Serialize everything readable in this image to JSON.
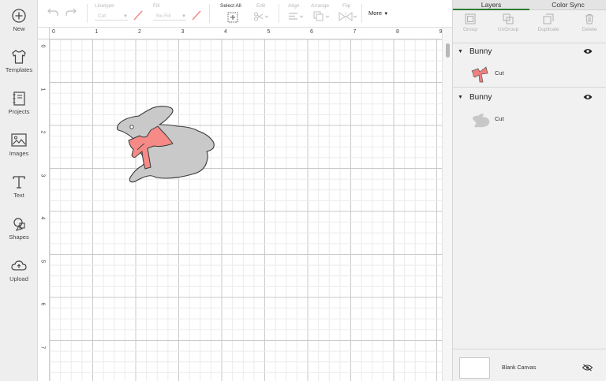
{
  "sidebar": {
    "items": [
      {
        "label": "New",
        "icon": "plus-circle-icon"
      },
      {
        "label": "Templates",
        "icon": "tshirt-icon"
      },
      {
        "label": "Projects",
        "icon": "notebook-icon"
      },
      {
        "label": "Images",
        "icon": "image-icon"
      },
      {
        "label": "Text",
        "icon": "text-icon"
      },
      {
        "label": "Shapes",
        "icon": "shapes-icon"
      },
      {
        "label": "Upload",
        "icon": "cloud-upload-icon"
      }
    ]
  },
  "toolbar": {
    "linetype_label": "Linetype",
    "linetype_value": "Cut",
    "fill_label": "Fill",
    "fill_value": "No Fill",
    "select_all_label": "Select All",
    "edit_label": "Edit",
    "align_label": "Align",
    "arrange_label": "Arrange",
    "flip_label": "Flip",
    "more_label": "More"
  },
  "rulers": {
    "top": [
      "0",
      "1",
      "2",
      "3",
      "4",
      "5",
      "6",
      "7",
      "8",
      "9"
    ],
    "left": [
      "0",
      "1",
      "2",
      "3",
      "4",
      "5",
      "6",
      "7"
    ]
  },
  "panel": {
    "tabs": [
      "Layers",
      "Color Sync"
    ],
    "actions": [
      "Group",
      "UnGroup",
      "Duplicate",
      "Delete"
    ],
    "groups": [
      {
        "name": "Bunny",
        "layer": "Cut",
        "thumb_color": "#f07f7f"
      },
      {
        "name": "Bunny",
        "layer": "Cut",
        "thumb_color": "#c8c8c8"
      }
    ],
    "blank_canvas_label": "Blank Canvas"
  },
  "colors": {
    "bunny_fill": "#c9c9c9",
    "bow_fill": "#f58a86",
    "active_tab": "#2e7d32"
  }
}
